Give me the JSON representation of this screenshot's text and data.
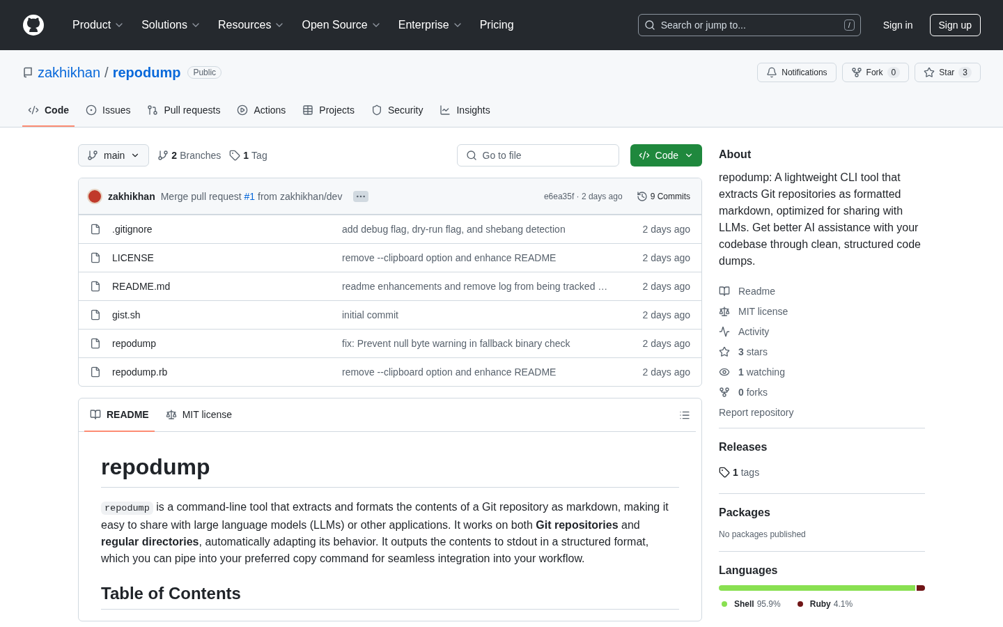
{
  "header": {
    "nav": [
      {
        "label": "Product",
        "has_menu": true
      },
      {
        "label": "Solutions",
        "has_menu": true
      },
      {
        "label": "Resources",
        "has_menu": true
      },
      {
        "label": "Open Source",
        "has_menu": true
      },
      {
        "label": "Enterprise",
        "has_menu": true
      },
      {
        "label": "Pricing",
        "has_menu": false
      }
    ],
    "search": {
      "placeholder": "Search or jump to...",
      "shortcut": "/"
    },
    "sign_in": "Sign in",
    "sign_up": "Sign up"
  },
  "repo": {
    "owner": "zakhikhan",
    "separator": "/",
    "name": "repodump",
    "visibility": "Public",
    "actions": [
      {
        "kind": "bell",
        "label": "Notifications"
      },
      {
        "kind": "fork",
        "label": "Fork",
        "count": "0"
      },
      {
        "kind": "star",
        "label": "Star",
        "count": "3"
      }
    ],
    "tabs": [
      {
        "kind": "code",
        "label": "Code",
        "selected": true
      },
      {
        "kind": "issues",
        "label": "Issues",
        "selected": false
      },
      {
        "kind": "pulls",
        "label": "Pull requests",
        "selected": false
      },
      {
        "kind": "actions",
        "label": "Actions",
        "selected": false
      },
      {
        "kind": "projects",
        "label": "Projects",
        "selected": false
      },
      {
        "kind": "security",
        "label": "Security",
        "selected": false
      },
      {
        "kind": "insights",
        "label": "Insights",
        "selected": false
      }
    ]
  },
  "toolbar": {
    "branch": "main",
    "branches_count": "2",
    "branches_label": "Branches",
    "tags_count": "1",
    "tags_label": "Tag",
    "go_to_file": "Go to file",
    "code_button": "Code"
  },
  "commit": {
    "author": "zakhikhan",
    "message_before": "Merge pull request",
    "pr": "#1",
    "message_after": "from zakhikhan/dev",
    "sha_time": "e6ea35f · 2 days ago",
    "commits": "9 Commits"
  },
  "files": [
    {
      "name": ".gitignore",
      "message": "add debug flag, dry-run flag, and shebang detection",
      "time": "2 days ago"
    },
    {
      "name": "LICENSE",
      "message": "remove --clipboard option and enhance README",
      "time": "2 days ago"
    },
    {
      "name": "README.md",
      "message": "readme enhancements and remove log from being tracked …",
      "time": "2 days ago"
    },
    {
      "name": "gist.sh",
      "message": "initial commit",
      "time": "2 days ago"
    },
    {
      "name": "repodump",
      "message": "fix: Prevent null byte warning in fallback binary check",
      "time": "2 days ago"
    },
    {
      "name": "repodump.rb",
      "message": "remove --clipboard option and enhance README",
      "time": "2 days ago"
    }
  ],
  "readme": {
    "tabs": [
      {
        "kind": "book",
        "label": "README",
        "selected": true
      },
      {
        "kind": "law",
        "label": "MIT license",
        "selected": false
      }
    ],
    "title": "repodump",
    "code": "repodump",
    "paragraph": "is a command-line tool that extracts and formats the contents of a Git repository as markdown, making it easy to share with large language models (LLMs) or other applications. It works on both **Git repositories** and **regular directories**, automatically adapting its behavior. It outputs the contents to stdout in a structured format, which you can pipe into your preferred copy command for seamless integration into your workflow.",
    "toc_title": "Table of Contents"
  },
  "about": {
    "title": "About",
    "description": "repodump: A lightweight CLI tool that extracts Git repositories as formatted markdown, optimized for sharing with LLMs. Get better AI assistance with your codebase through clean, structured code dumps.",
    "links": [
      {
        "kind": "book",
        "label": "Readme"
      },
      {
        "kind": "law",
        "label": "MIT license"
      },
      {
        "kind": "pulse",
        "label": "Activity"
      },
      {
        "kind": "star",
        "count": "3",
        "label": "stars"
      },
      {
        "kind": "eye",
        "count": "1",
        "label": "watching"
      },
      {
        "kind": "fork",
        "count": "0",
        "label": "forks"
      }
    ],
    "report": "Report repository"
  },
  "releases": {
    "title": "Releases",
    "count": "1",
    "label": "tags"
  },
  "packages": {
    "title": "Packages",
    "note": "No packages published"
  },
  "languages": {
    "title": "Languages",
    "items": [
      {
        "name": "Shell",
        "percent": "95.9%",
        "level": 0.959,
        "color": "#89e051"
      },
      {
        "name": "Ruby",
        "percent": "4.1%",
        "level": 0.041,
        "color": "#701516"
      }
    ]
  }
}
